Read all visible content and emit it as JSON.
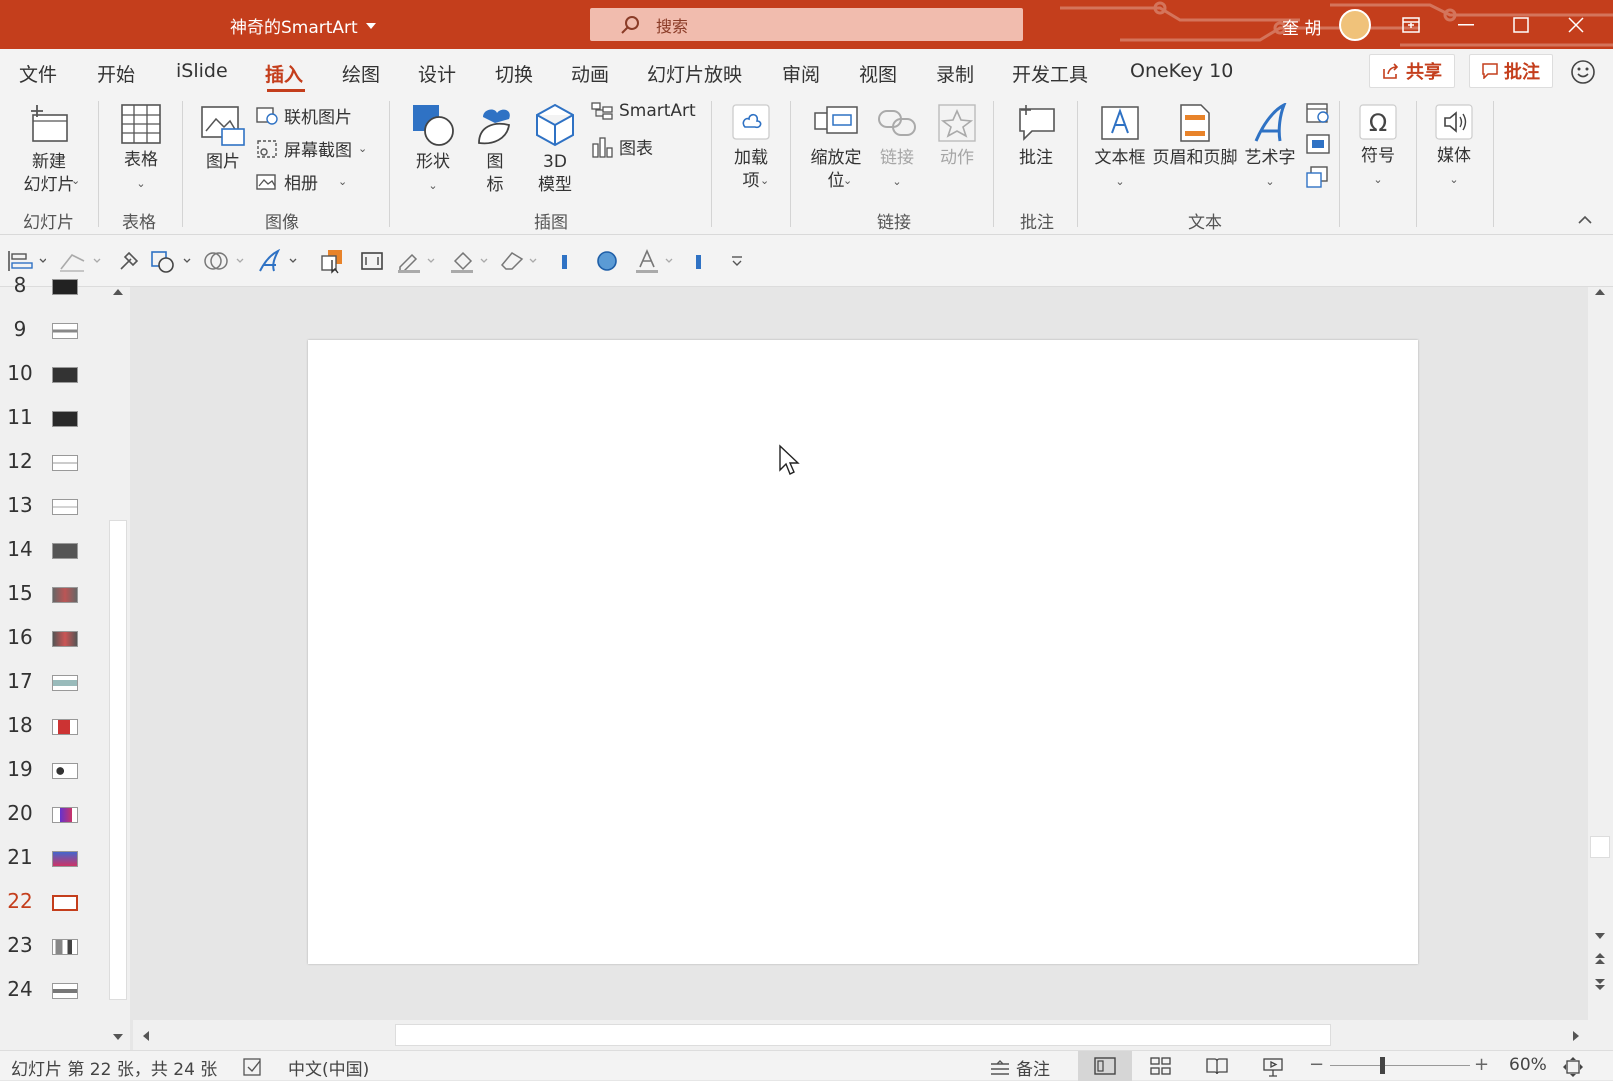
{
  "titlebar": {
    "doc_title": "神奇的SmartArt",
    "search_placeholder": "搜索",
    "user_name": "奎 胡"
  },
  "menu": {
    "tabs": [
      "文件",
      "开始",
      "iSlide",
      "插入",
      "绘图",
      "设计",
      "切换",
      "动画",
      "幻灯片放映",
      "审阅",
      "视图",
      "录制",
      "开发工具",
      "OneKey 10"
    ],
    "active_tab": "插入",
    "share_label": "共享",
    "comment_label": "批注"
  },
  "ribbon": {
    "new_slide": "新建\n幻灯片",
    "table": "表格",
    "picture": "图片",
    "online_picture": "联机图片",
    "screenshot": "屏幕截图",
    "album": "相册",
    "shapes": "形状",
    "icons": "图\n标",
    "model3d": "3D\n模型",
    "smartart": "SmartArt",
    "chart": "图表",
    "addins": "加载\n项",
    "zoom": "缩放定\n位",
    "link": "链接",
    "action": "动作",
    "comment": "批注",
    "textbox": "文本框",
    "header_footer": "页眉和页脚",
    "wordart": "艺术字",
    "symbol": "符号",
    "media": "媒体",
    "groups": {
      "slides": "幻灯片",
      "tables": "表格",
      "images": "图像",
      "illustrations": "插图",
      "links": "链接",
      "comments": "批注",
      "text": "文本"
    }
  },
  "thumbnails": {
    "partial_top": "8",
    "items": [
      "9",
      "10",
      "11",
      "12",
      "13",
      "14",
      "15",
      "16",
      "17",
      "18",
      "19",
      "20",
      "21",
      "22",
      "23",
      "24"
    ],
    "selected": "22"
  },
  "statusbar": {
    "slide_info": "幻灯片 第 22 张，共 24 张",
    "language": "中文(中国)",
    "notes": "备注",
    "zoom": "60%",
    "zoom_level_fraction": 0.37
  },
  "colors": {
    "accent": "#c43e1c",
    "search_bg": "#f1bcae",
    "ribbon_bg": "#f3f3f3",
    "workspace_bg": "#e6e6e6",
    "icon_blue": "#2f72c4"
  }
}
